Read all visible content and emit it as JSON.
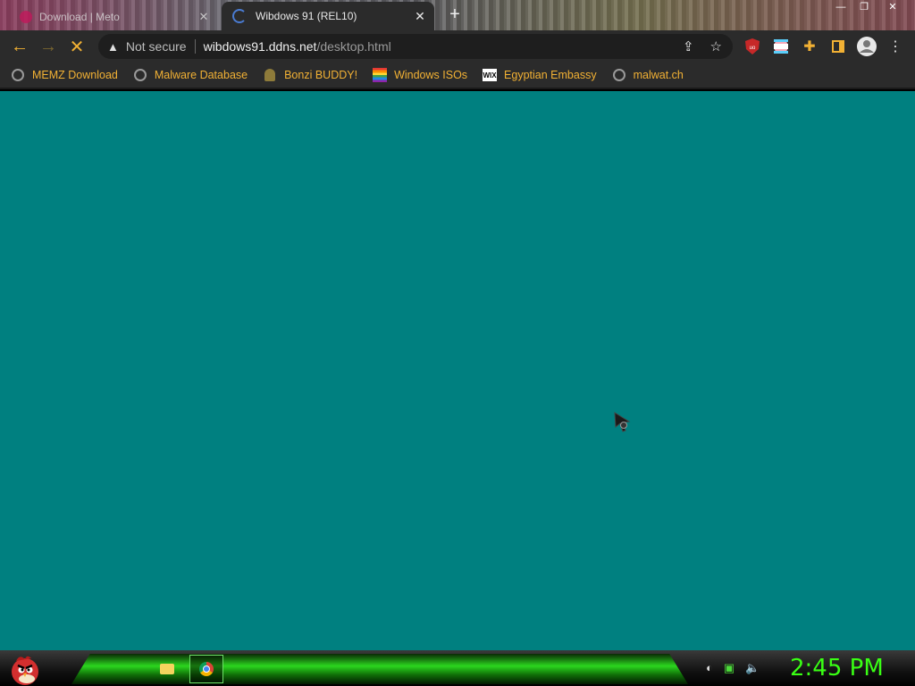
{
  "browser": {
    "tabs": [
      {
        "title": "Download | Meto",
        "active": false
      },
      {
        "title": "Wibdows 91 (REL10)",
        "active": true
      }
    ],
    "new_tab_symbol": "+",
    "window_controls": [
      "—",
      "❐",
      "✕"
    ],
    "address": {
      "security_label": "Not secure",
      "host": "wibdows91.ddns.net",
      "path": "/desktop.html"
    },
    "toolbar_icons": [
      "back-arrow-icon",
      "forward-arrow-icon",
      "stop-loading-icon",
      "share-icon",
      "star-icon",
      "ublock-icon",
      "profile-flag-icon",
      "puzzle-icon",
      "sidebar-icon",
      "account-icon",
      "menu-icon"
    ],
    "bookmarks": [
      {
        "label": "MEMZ Download",
        "icon": "globe-icon"
      },
      {
        "label": "Malware Database",
        "icon": "globe-icon"
      },
      {
        "label": "Bonzi BUDDY!",
        "icon": "bonzi-icon"
      },
      {
        "label": "Windows ISOs",
        "icon": "rainbow-flag-icon"
      },
      {
        "label": "Egyptian Embassy",
        "icon": "wix-icon"
      },
      {
        "label": "malwat.ch",
        "icon": "globe-icon"
      }
    ]
  },
  "desktop": {
    "background_color": "#008080"
  },
  "taskbar": {
    "start_icon": "angry-bird-icon",
    "items": [
      "file-explorer-icon",
      "chrome-icon"
    ],
    "tray_icons": [
      "steam-icon",
      "monitor-icon",
      "volume-icon"
    ],
    "clock": "2:45 PM",
    "clock_color": "#39ff14"
  },
  "colors": {
    "accent": "#f2b134",
    "toolbar_bg": "#2b2b2b"
  }
}
